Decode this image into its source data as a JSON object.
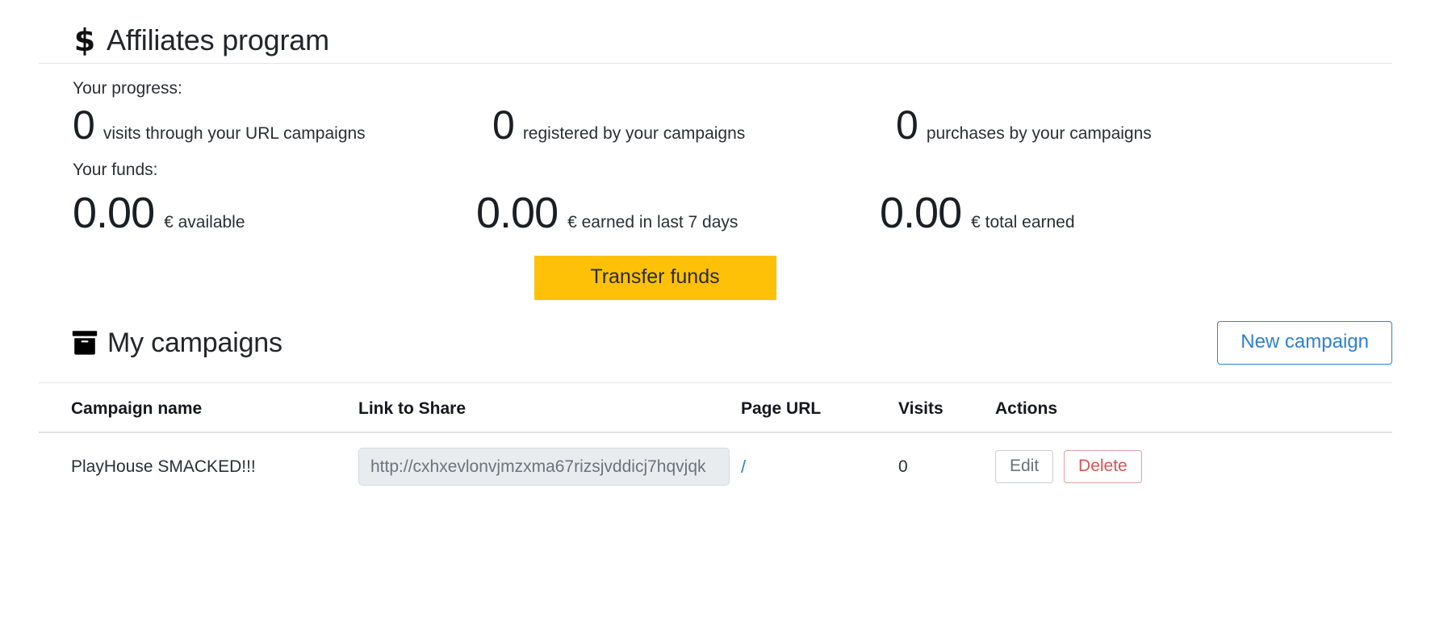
{
  "affiliates": {
    "icon": "dollar-icon",
    "title": "Affiliates program",
    "progress_label": "Your progress:",
    "progress_stats": [
      {
        "value": "0",
        "label": "visits through your URL campaigns"
      },
      {
        "value": "0",
        "label": "registered by your campaigns"
      },
      {
        "value": "0",
        "label": "purchases by your campaigns"
      }
    ],
    "funds_label": "Your funds:",
    "funds_stats": [
      {
        "value": "0.00",
        "label": "€ available"
      },
      {
        "value": "0.00",
        "label": "€ earned in last 7 days"
      },
      {
        "value": "0.00",
        "label": "€ total earned"
      }
    ],
    "transfer_button": "Transfer funds"
  },
  "campaigns": {
    "icon": "archive-icon",
    "title": "My campaigns",
    "new_campaign_button": "New campaign",
    "table": {
      "headers": [
        "Campaign name",
        "Link to Share",
        "Page URL",
        "Visits",
        "Actions"
      ],
      "rows": [
        {
          "name": "PlayHouse SMACKED!!!",
          "link": "http://cxhxevlonvjmzxma67rizsjvddicj7hqvjqk",
          "page_url": "/",
          "visits": "0",
          "edit_label": "Edit",
          "delete_label": "Delete"
        }
      ]
    }
  },
  "colors": {
    "transfer_button_bg": "#ffc107",
    "accent_blue": "#2f80d0",
    "danger_red": "#d9534f",
    "input_bg": "#e9ecef",
    "divider": "#e3e5e8"
  }
}
